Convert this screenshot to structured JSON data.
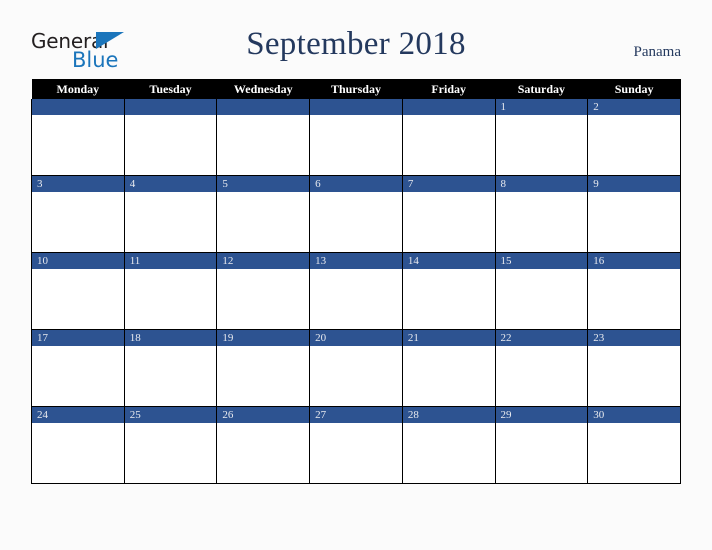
{
  "brand": {
    "line1": "General",
    "line2": "Blue",
    "triangle_icon": "blue-triangle-icon",
    "color_dark": "#231f20",
    "color_blue": "#1b75bb"
  },
  "header": {
    "title": "September 2018",
    "region": "Panama",
    "title_color": "#24395e"
  },
  "calendar": {
    "weekday_headers": [
      "Monday",
      "Tuesday",
      "Wednesday",
      "Thursday",
      "Friday",
      "Saturday",
      "Sunday"
    ],
    "header_bg": "#000000",
    "daynum_bg": "#2d5391",
    "daynum_color": "#e8eaef",
    "weeks": [
      [
        {
          "num": "",
          "filled": false
        },
        {
          "num": "",
          "filled": false
        },
        {
          "num": "",
          "filled": false
        },
        {
          "num": "",
          "filled": false
        },
        {
          "num": "",
          "filled": false
        },
        {
          "num": "1",
          "filled": true
        },
        {
          "num": "2",
          "filled": true
        }
      ],
      [
        {
          "num": "3",
          "filled": true
        },
        {
          "num": "4",
          "filled": true
        },
        {
          "num": "5",
          "filled": true
        },
        {
          "num": "6",
          "filled": true
        },
        {
          "num": "7",
          "filled": true
        },
        {
          "num": "8",
          "filled": true
        },
        {
          "num": "9",
          "filled": true
        }
      ],
      [
        {
          "num": "10",
          "filled": true
        },
        {
          "num": "11",
          "filled": true
        },
        {
          "num": "12",
          "filled": true
        },
        {
          "num": "13",
          "filled": true
        },
        {
          "num": "14",
          "filled": true
        },
        {
          "num": "15",
          "filled": true
        },
        {
          "num": "16",
          "filled": true
        }
      ],
      [
        {
          "num": "17",
          "filled": true
        },
        {
          "num": "18",
          "filled": true
        },
        {
          "num": "19",
          "filled": true
        },
        {
          "num": "20",
          "filled": true
        },
        {
          "num": "21",
          "filled": true
        },
        {
          "num": "22",
          "filled": true
        },
        {
          "num": "23",
          "filled": true
        }
      ],
      [
        {
          "num": "24",
          "filled": true
        },
        {
          "num": "25",
          "filled": true
        },
        {
          "num": "26",
          "filled": true
        },
        {
          "num": "27",
          "filled": true
        },
        {
          "num": "28",
          "filled": true
        },
        {
          "num": "29",
          "filled": true
        },
        {
          "num": "30",
          "filled": true
        }
      ]
    ]
  }
}
